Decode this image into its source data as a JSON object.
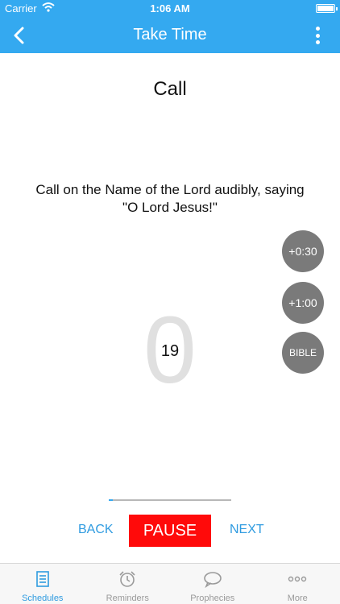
{
  "status_bar": {
    "carrier": "Carrier",
    "time": "1:06 AM"
  },
  "nav_bar": {
    "title": "Take Time"
  },
  "step": {
    "title": "Call",
    "instruction_line1": "Call on the Name of the Lord audibly, saying",
    "instruction_line2": "\"O Lord Jesus!\""
  },
  "side_buttons": {
    "add_30": "+0:30",
    "add_60": "+1:00",
    "bible": "BIBLE"
  },
  "timer": {
    "big_digit": "0",
    "seconds": "19",
    "progress_fraction": 0.03
  },
  "controls": {
    "back": "BACK",
    "pause": "PAUSE",
    "next": "NEXT"
  },
  "tab_bar": {
    "tabs": [
      {
        "label": "Schedules",
        "icon": "list-icon",
        "active": true
      },
      {
        "label": "Reminders",
        "icon": "alarm-clock-icon",
        "active": false
      },
      {
        "label": "Prophecies",
        "icon": "speech-bubble-icon",
        "active": false
      },
      {
        "label": "More",
        "icon": "more-dots-icon",
        "active": false
      }
    ]
  },
  "colors": {
    "accent": "#34a9f0",
    "pause": "#ff0a0a",
    "side_button": "#7a7a7a"
  }
}
